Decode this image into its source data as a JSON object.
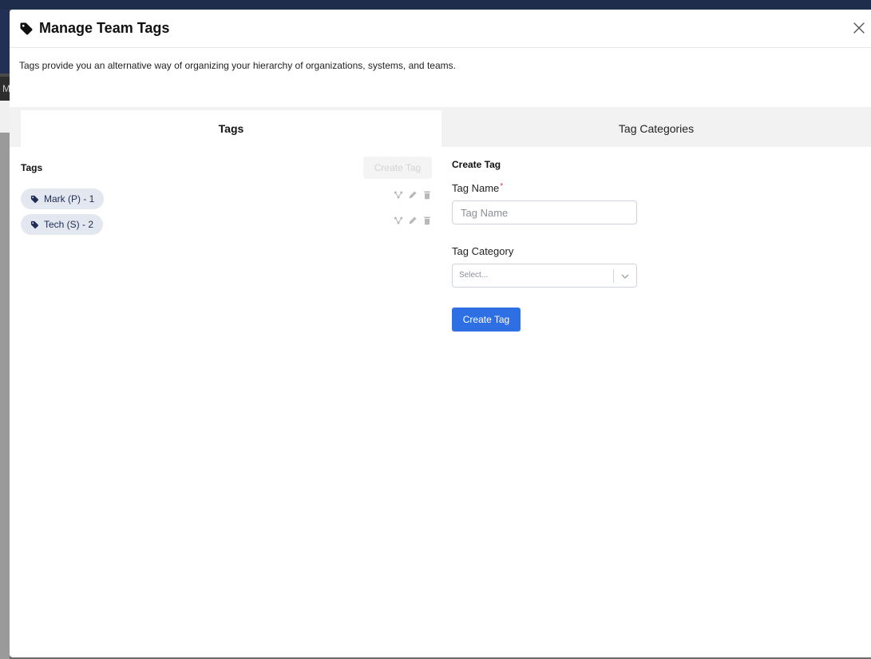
{
  "backdrop": {
    "partial_letter": "M"
  },
  "modal": {
    "title": "Manage Team Tags",
    "description": "Tags provide you an alternative way of organizing your hierarchy of organizations, systems, and teams."
  },
  "tabs": [
    {
      "label": "Tags",
      "active": true
    },
    {
      "label": "Tag Categories",
      "active": false
    }
  ],
  "tags_panel": {
    "heading": "Tags",
    "create_button": "Create Tag",
    "items": [
      {
        "label": "Mark (P) - 1"
      },
      {
        "label": "Tech (S) - 2"
      }
    ]
  },
  "create_form": {
    "heading": "Create Tag",
    "tag_name_label": "Tag Name",
    "required_mark": "*",
    "tag_name_placeholder": "Tag Name",
    "tag_category_label": "Tag Category",
    "tag_category_placeholder": "Select...",
    "submit_label": "Create Tag"
  },
  "colors": {
    "primary": "#2f6fe4",
    "tag_pill_bg": "#e3e7ef",
    "tag_pill_text": "#1f2d55",
    "required": "#e23a3a"
  },
  "icons": {
    "title": "tag-icon",
    "close": "close-icon",
    "pill": "tag-icon",
    "actions": [
      "hierarchy-icon",
      "pencil-icon",
      "trash-icon"
    ],
    "select": "chevron-down-icon"
  }
}
